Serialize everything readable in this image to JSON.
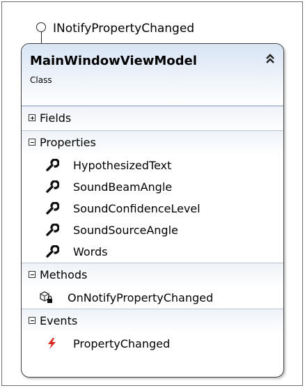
{
  "interface": {
    "name": "INotifyPropertyChanged"
  },
  "class": {
    "name": "MainWindowViewModel",
    "stereotype": "Class"
  },
  "sections": {
    "fields": {
      "label": "Fields",
      "state": "collapsed"
    },
    "properties": {
      "label": "Properties",
      "state": "expanded",
      "items": [
        "HypothesizedText",
        "SoundBeamAngle",
        "SoundConfidenceLevel",
        "SoundSourceAngle",
        "Words"
      ]
    },
    "methods": {
      "label": "Methods",
      "state": "expanded",
      "items": [
        "OnNotifyPropertyChanged"
      ]
    },
    "events": {
      "label": "Events",
      "state": "expanded",
      "items": [
        "PropertyChanged"
      ]
    }
  },
  "icons": {
    "property": "wrench-icon",
    "method": "method-cube-lock-icon",
    "event": "lightning-icon",
    "collapse": "double-chevron-up-icon"
  },
  "colors": {
    "header_top": "#d8e4f4",
    "event_icon": "#d9261c"
  }
}
